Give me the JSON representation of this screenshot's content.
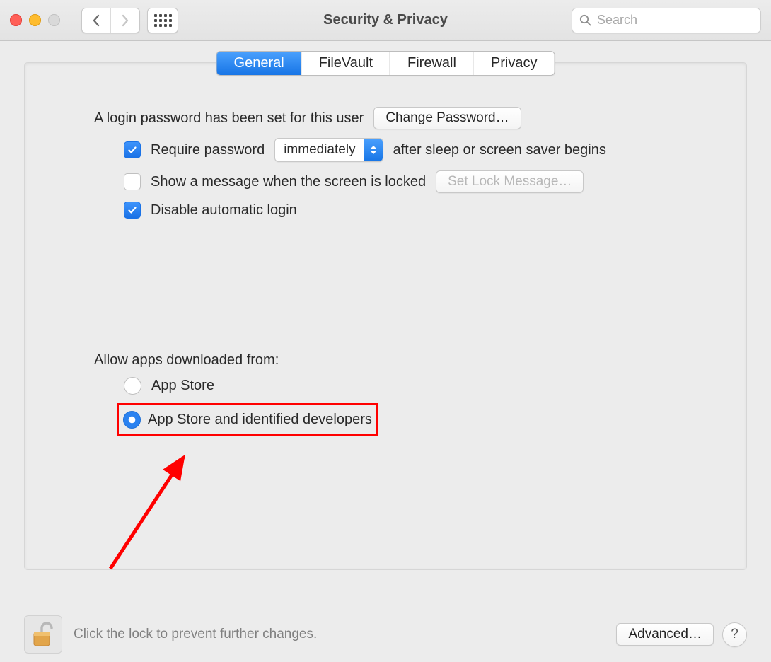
{
  "window": {
    "title": "Security & Privacy"
  },
  "search": {
    "placeholder": "Search"
  },
  "tabs": {
    "general": "General",
    "filevault": "FileVault",
    "firewall": "Firewall",
    "privacy": "Privacy"
  },
  "login": {
    "passwordSetText": "A login password has been set for this user",
    "changePasswordBtn": "Change Password…",
    "requirePasswordLabel": "Require password",
    "requirePasswordDelay": "immediately",
    "afterSleepText": "after sleep or screen saver begins",
    "showMessageLabel": "Show a message when the screen is locked",
    "setLockMessageBtn": "Set Lock Message…",
    "disableAutoLoginLabel": "Disable automatic login"
  },
  "gatekeeper": {
    "heading": "Allow apps downloaded from:",
    "option1": "App Store",
    "option2": "App Store and identified developers"
  },
  "footer": {
    "lockText": "Click the lock to prevent further changes.",
    "advancedBtn": "Advanced…",
    "helpBtn": "?"
  }
}
